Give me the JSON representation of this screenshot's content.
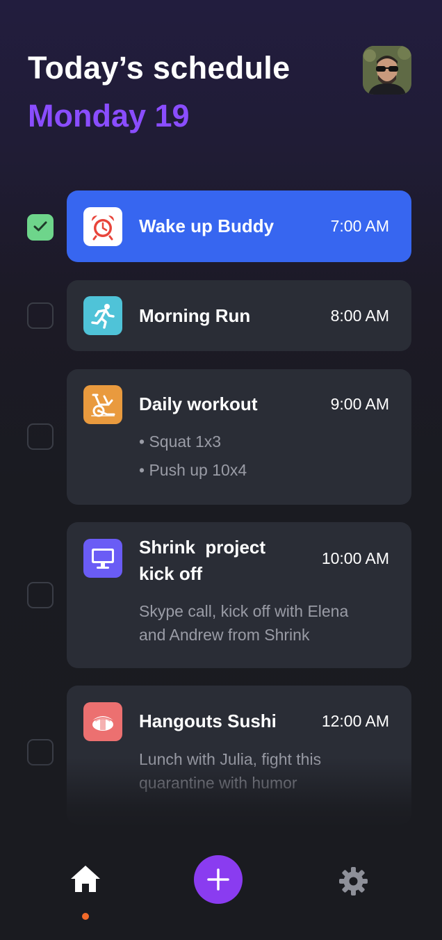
{
  "header": {
    "title": "Today’s schedule",
    "date": "Monday 19",
    "accent_color": "#8a4dff"
  },
  "avatar": {
    "icon": "user-avatar-photo"
  },
  "tasks": [
    {
      "title": "Wake up Buddy",
      "time": "7:00 AM",
      "checked": true,
      "active": true,
      "icon": "alarm-clock-icon",
      "icon_color": "#ffffff"
    },
    {
      "title": "Morning Run",
      "time": "8:00 AM",
      "checked": false,
      "icon": "running-person-icon",
      "icon_color": "#4fc3d8"
    },
    {
      "title": "Daily workout",
      "time": "9:00 AM",
      "checked": false,
      "icon": "exercise-bike-icon",
      "icon_color": "#e99a3e",
      "items": [
        "Squat 1x3",
        "Push up 10x4"
      ]
    },
    {
      "title_line1": "Shrink  project",
      "title_line2": "kick off",
      "time": "10:00 AM",
      "checked": false,
      "icon": "monitor-icon",
      "icon_color": "#6a5cf5",
      "desc_line1": "Skype call, kick off with Elena",
      "desc_line2": "and Andrew from Shrink"
    },
    {
      "title": "Hangouts Sushi",
      "time": "12:00 AM",
      "checked": false,
      "icon": "sushi-icon",
      "icon_color": "#ec7070",
      "desc_line1": "Lunch with Julia, fight this",
      "desc_line2": "quarantine with humor"
    }
  ],
  "nav": {
    "home_icon": "home-icon",
    "add_icon": "plus-icon",
    "settings_icon": "gear-icon",
    "active_indicator_color": "#f26a2a",
    "add_button_color": "#8a3cf0"
  }
}
